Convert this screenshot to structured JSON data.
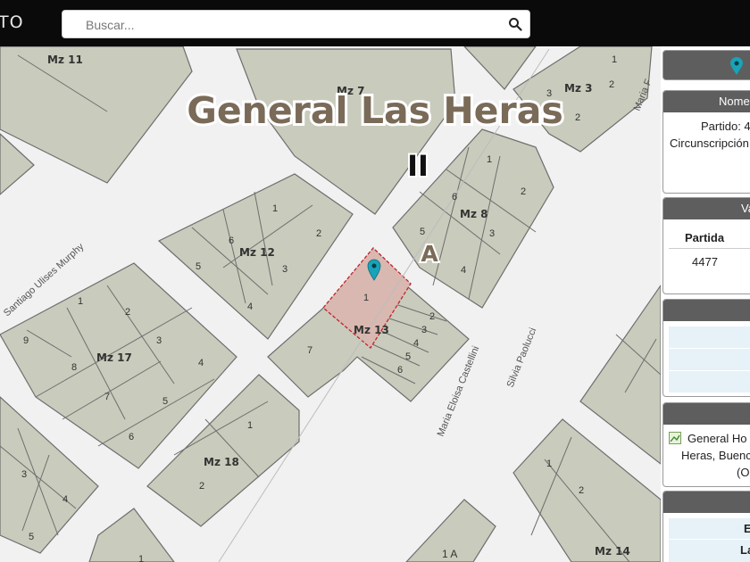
{
  "app": {
    "brand": "TO"
  },
  "search": {
    "placeholder": "Buscar..."
  },
  "map": {
    "title": "General Las Heras",
    "labels": {
      "zone_ii": "II",
      "zone_a": "A",
      "mz11": "Mz 11",
      "mz7": "Mz 7",
      "mz3": "Mz 3",
      "mz8": "Mz 8",
      "mz12": "Mz 12",
      "mz13": "Mz 13",
      "mz17": "Mz 17",
      "mz18": "Mz 18",
      "mz14": "Mz 14",
      "street_murphy": "Santiago Ulises Murphy",
      "street_castellini": "Maria Eloisa Castellini",
      "street_paolucci": "Silvia Paolucci",
      "street_maria": "Maria F",
      "lot_1a": "1 A"
    },
    "marker_color": "#18a3b8"
  },
  "panel": {
    "nomenclatura": {
      "header": "Nome",
      "partido": "Partido: 4",
      "circ": "Circunscripción"
    },
    "valuacion": {
      "header": "Va",
      "col": "Partida",
      "value": "4477"
    },
    "ubicacion": {
      "line1": "General Ho",
      "line2": "Heras, Buenc",
      "line3": "(Op"
    },
    "extra": {
      "row1": "E",
      "row2": "La"
    }
  }
}
